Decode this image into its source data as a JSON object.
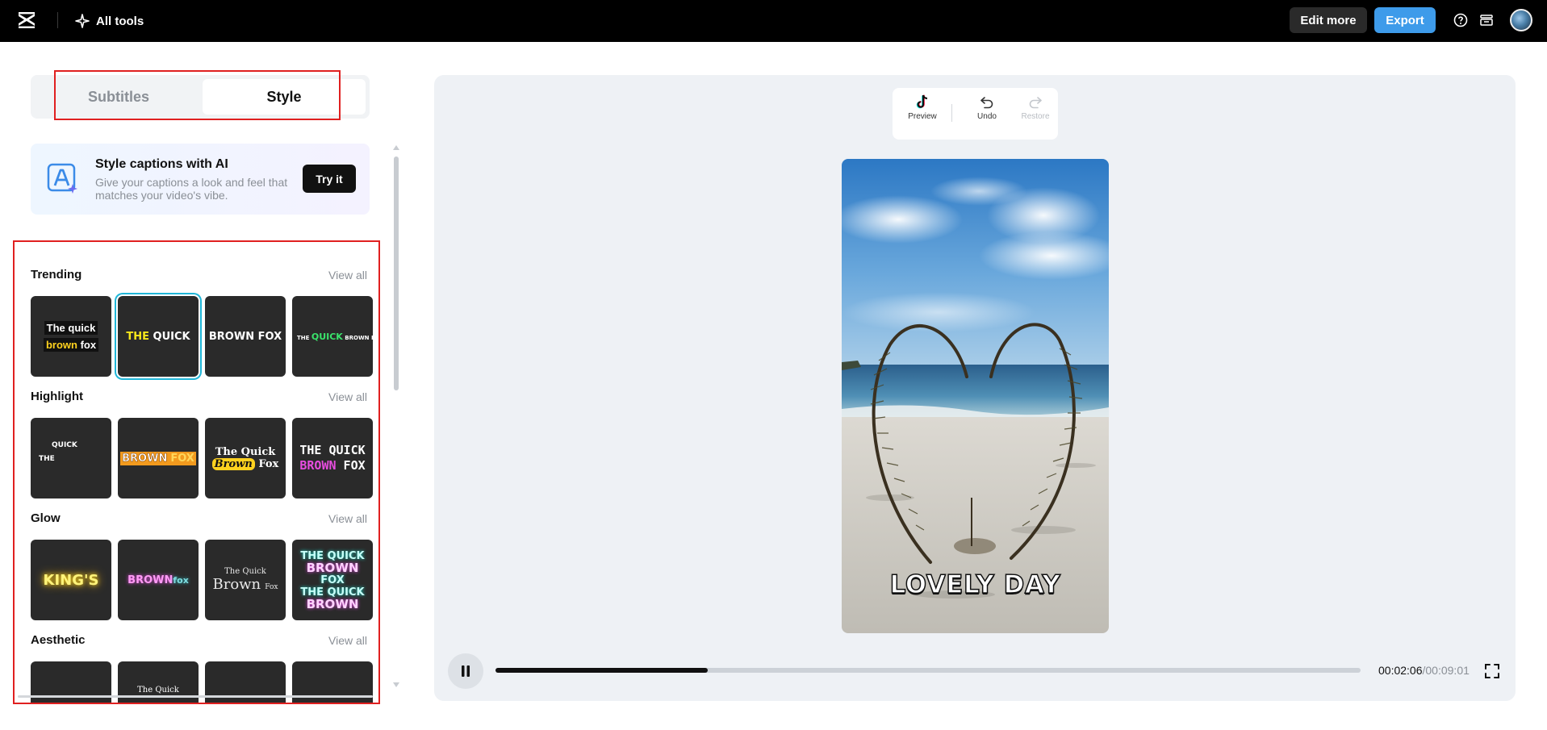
{
  "topbar": {
    "all_tools": "All tools",
    "edit_more": "Edit more",
    "export": "Export",
    "colors": {
      "background": "#000000",
      "export": "#3e9bea"
    },
    "icons": [
      "capcut-logo-icon",
      "sparkle-icon",
      "help-icon",
      "inbox-icon",
      "avatar"
    ]
  },
  "tabs": {
    "subtitles": "Subtitles",
    "style": "Style",
    "active": "Style"
  },
  "ai_card": {
    "title": "Style captions with AI",
    "description": "Give your captions a look and feel that matches your video's vibe.",
    "button": "Try it"
  },
  "sections": {
    "trending": {
      "title": "Trending",
      "view_all": "View all",
      "tiles": [
        {
          "line1": "The quick",
          "line2a": "brown",
          "line2b": "fox"
        },
        {
          "a": "THE",
          "b": "QUICK",
          "selected": true
        },
        {
          "a": "BROWN FOX"
        },
        {
          "a": "THE",
          "b": "QUICK",
          "c": "BROWN FOX"
        }
      ]
    },
    "highlight": {
      "title": "Highlight",
      "view_all": "View all",
      "tiles": [
        {
          "a": "QUICK",
          "b": "THE"
        },
        {
          "a": "BROWN",
          "b": "FOX"
        },
        {
          "a": "The Quick",
          "b": "Brown",
          "c": "Fox"
        },
        {
          "a": "THE QUICK",
          "b": "BROWN",
          "c": "FOX"
        }
      ]
    },
    "glow": {
      "title": "Glow",
      "view_all": "View all",
      "tiles": [
        {
          "a": "KING'S"
        },
        {
          "a": "BROWN",
          "b": "fox"
        },
        {
          "a": "The Quick",
          "b": "Brown",
          "c": "Fox"
        },
        {
          "a": "THE QUICK",
          "b": "BROWN",
          "c": "FOX",
          "d": "THE QUICK",
          "e": "BROWN"
        }
      ]
    },
    "aesthetic": {
      "title": "Aesthetic",
      "view_all": "View all",
      "tiles": [
        {
          "a": ""
        },
        {
          "a": "The Quick"
        },
        {
          "a": ""
        },
        {
          "a": ""
        }
      ]
    }
  },
  "toolbar": {
    "preview": "Preview",
    "undo": "Undo",
    "restore": "Restore"
  },
  "video": {
    "caption": "LOVELY DAY"
  },
  "player": {
    "current_time": "00:02:06",
    "total_time": "/00:09:01",
    "progress": 0.245
  }
}
